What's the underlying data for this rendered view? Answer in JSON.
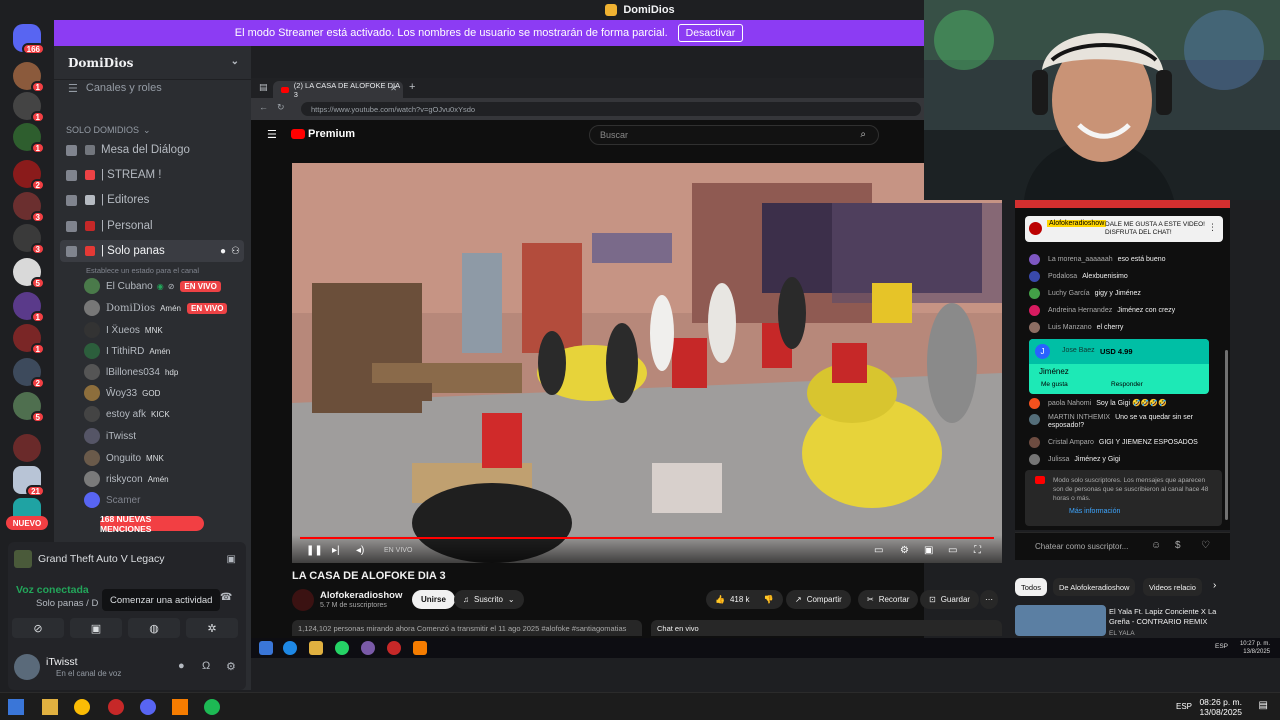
{
  "topbar": {
    "title": "DomiDios"
  },
  "streamer_mode": {
    "text": "El modo Streamer está activado. Los nombres de usuario se mostrarán de forma parcial.",
    "button": "Desactivar"
  },
  "rail": {
    "badges": [
      "166",
      "1",
      "1",
      "1",
      "2",
      "3",
      "3",
      "5",
      "1",
      "1",
      "2",
      "5",
      "21"
    ],
    "new_label": "NUEVO"
  },
  "sidebar": {
    "server_name": "DomiDios",
    "channels_roles": "Canales y roles",
    "category": "SOLO DOMIDIOS",
    "voice_channels": [
      {
        "name": "Mesa del Diálogo"
      },
      {
        "name": "| STREAM !"
      },
      {
        "name": "| Editores"
      },
      {
        "name": "| Personal"
      },
      {
        "name": "| Solo panas"
      }
    ],
    "channel_status_hint": "Establece un estado para el canal",
    "live_label": "EN VIVO",
    "users": [
      {
        "name": "El Cubano",
        "tag": "",
        "live": true
      },
      {
        "name": "DomiDios",
        "tag": "Amén",
        "live": true
      },
      {
        "name": "I Ẍueos",
        "tag": "MNK",
        "live": false
      },
      {
        "name": "I TithiRD",
        "tag": "Amén",
        "live": false
      },
      {
        "name": "lBillones034",
        "tag": "hdp",
        "live": false
      },
      {
        "name": "Ŵoy33",
        "tag": "GOD",
        "live": false
      },
      {
        "name": "estoy afk",
        "tag": "KICK",
        "live": false
      },
      {
        "name": "iTwisst",
        "tag": "",
        "live": false
      },
      {
        "name": "Onguito",
        "tag": "MNK",
        "live": false
      },
      {
        "name": "riskycon",
        "tag": "Amén",
        "live": false
      },
      {
        "name": "Scamer",
        "tag": "",
        "live": false
      }
    ],
    "mentions": "168 NUEVAS MENCIONES"
  },
  "panel": {
    "game": "Grand Theft Auto V Legacy",
    "voice_connected": "Voz conectada",
    "voice_channel": "Solo panas / D",
    "tooltip": "Comenzar una actividad",
    "user_name": "iTwisst",
    "user_status": "En el canal de voz"
  },
  "browser": {
    "tab_title": "(2) LA CASA DE ALOFOKE DIA 3",
    "url": "https://www.youtube.com/watch?v=gOJvu0xYsdo"
  },
  "youtube": {
    "logo": "Premium",
    "search_placeholder": "Buscar",
    "live_label": "EN VIVO",
    "video_title": "LA CASA DE ALOFOKE DIA 3",
    "channel_name": "Alofokeradioshow",
    "subscribers": "5.7 M de suscriptores",
    "join": "Unirse",
    "subscribed": "Suscrito",
    "likes": "418 k",
    "share": "Compartir",
    "clip": "Recortar",
    "save": "Guardar",
    "description": "1,124,102 personas mirando ahora  Comenzó a transmitir el 11 ago 2025  #alofoke #santiagomatias",
    "chat_live": "Chat en vivo"
  },
  "chat": {
    "pinned_name": "Alofokeradioshow",
    "pinned_text": "DALE ME GUSTA A ESTE VIDEO! DISFRUTA DEL CHAT!",
    "messages_top": [
      {
        "name": "La morena_aaaaaah",
        "text": "eso está bueno",
        "color": "#7e57c2"
      },
      {
        "name": "Podalosa",
        "text": "Alexbuenisimo",
        "color": "#3949ab"
      },
      {
        "name": "Luchy García",
        "text": "gigy y Jiménez",
        "color": "#43a047"
      },
      {
        "name": "Andreina Hernandez",
        "text": "Jiménez con crezy",
        "color": "#d81b60"
      },
      {
        "name": "Luis Manzano",
        "text": "el cherry",
        "color": "#8d6e63"
      }
    ],
    "superchat": {
      "initial": "J",
      "name": "Jose Baez",
      "amount": "USD 4.99",
      "message": "Jiménez",
      "like": "Me gusta",
      "reply": "Responder"
    },
    "messages_bottom": [
      {
        "name": "paola Nahomi",
        "text": "Soy la Gigi 🤣🤣🤣🤣",
        "color": "#f4511e"
      },
      {
        "name": "MARTIN INTHEMIX",
        "text": "Uno se va quedar sin ser esposado!?",
        "color": "#546e7a"
      },
      {
        "name": "Cristal Amparo",
        "text": "GIGI Y JIEMENZ ESPOSADOS",
        "color": "#6d4c41"
      },
      {
        "name": "Julissa",
        "text": "Jiménez y Gigi",
        "color": "#757575"
      }
    ],
    "subs_only": "Modo solo suscriptores. Los mensajes que aparecen son de personas que se suscribieron al canal hace 48 horas o más.",
    "more_info": "Más información",
    "input_placeholder": "Chatear como suscriptor..."
  },
  "recommendations": {
    "tabs": [
      "Todos",
      "De Alofokeradioshow",
      "Videos relacio"
    ],
    "title": "El Yala Ft. Lapiz Conciente X La Greña - CONTRARIO REMIX",
    "channel": "EL YALA"
  },
  "inner_taskbar": {
    "lang": "ESP",
    "time": "10:27 p. m.",
    "date": "13/8/2025"
  },
  "taskbar": {
    "lang": "ESP",
    "time": "08:26 p. m.",
    "date": "13/08/2025"
  }
}
